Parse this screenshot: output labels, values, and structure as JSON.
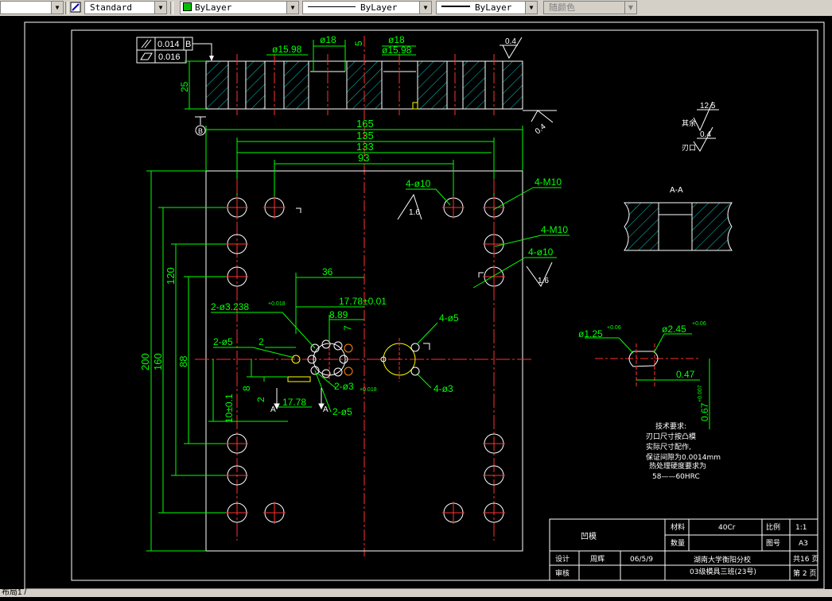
{
  "toolbar": {
    "textstyle": "Standard",
    "layer_color": "ByLayer",
    "linetype": "ByLayer",
    "lineweight": "ByLayer",
    "plotstyle": "随颜色"
  },
  "drawing": {
    "gdt_parallel": "0.014",
    "gdt_datum": "B",
    "gdt_flatness": "0.016",
    "dim_25": "25",
    "dim_15_98_a": "ø15.98",
    "dim_18_a": "ø18",
    "dim_5": "5",
    "dim_18_b": "ø18",
    "dim_15_98_b": "ø15.98",
    "rough_04_top": "0.4",
    "rough_04_mid": "0.4",
    "datum_label": "B",
    "dim_165": "165",
    "dim_135": "135",
    "dim_133": "133",
    "dim_93": "93",
    "dim_200": "200",
    "dim_160": "160",
    "dim_120": "120",
    "dim_88": "88",
    "dim_36": "36",
    "dim_17_78_top": "17.78±0.01",
    "dim_8_89": "8.89",
    "dim_7": "7",
    "dim_2_3238": "2-ø3.238",
    "dim_2_3238_tol": "+0.018",
    "dim_2_5a": "2-ø5",
    "dim_2": "2",
    "dim_2_3": "2-ø3",
    "dim_2_3_tol": "+0.018",
    "dim_8": "8",
    "dim_2b": "2",
    "dim_17_78_bot": "17.78",
    "dim_2_5b": "2-ø5",
    "dim_10_01": "10±0.1",
    "sec_A1": "A",
    "sec_A2": "A",
    "dim_4_5": "4-ø5",
    "dim_4_3": "4-ø3",
    "dim_4_10_top": "4-ø10",
    "dim_4_10_mid": "4-ø10",
    "rough_16_a": "1.6",
    "rough_16_b": "1.6",
    "dim_4_M10_a": "4-M10",
    "dim_4_M10_b": "4-M10",
    "rough_12_5": "12.5",
    "rough_rest_label": "其余",
    "rough_04_edge": "0.4",
    "edge_label": "刃口",
    "section_aa": "A-A",
    "detail_125": "ø1.25",
    "detail_125_tol": "+0.06",
    "detail_245": "ø2.45",
    "detail_245_tol": "+0.06",
    "detail_047": "0.47",
    "detail_067": "0.67",
    "detail_067_tol": "+0.007",
    "notes_title": "技术要求:",
    "notes_1": "刃口尺寸按凸模",
    "notes_2": "实际尺寸配作,",
    "notes_3": "保证间隙为0.0014mm",
    "notes_4": "热处理硬度要求为",
    "notes_5": "58——60HRC"
  },
  "titleblock": {
    "part_name": "凹模",
    "material_label": "材料",
    "material_value": "40Cr",
    "scale_label": "比例",
    "scale_value": "1:1",
    "qty_label": "数量",
    "drawing_no_label": "图号",
    "drawing_no_value": "A3",
    "designer_label": "设计",
    "designer_name": "周辉",
    "date": "06/5/9",
    "school": "湖南大学衡阳分校",
    "class": "03级模具三班(23号)",
    "total_pages": "共16 页",
    "page_no": "第 2 页",
    "reviewer_label": "审核"
  },
  "statusbar": {
    "text": "布局1 /"
  }
}
